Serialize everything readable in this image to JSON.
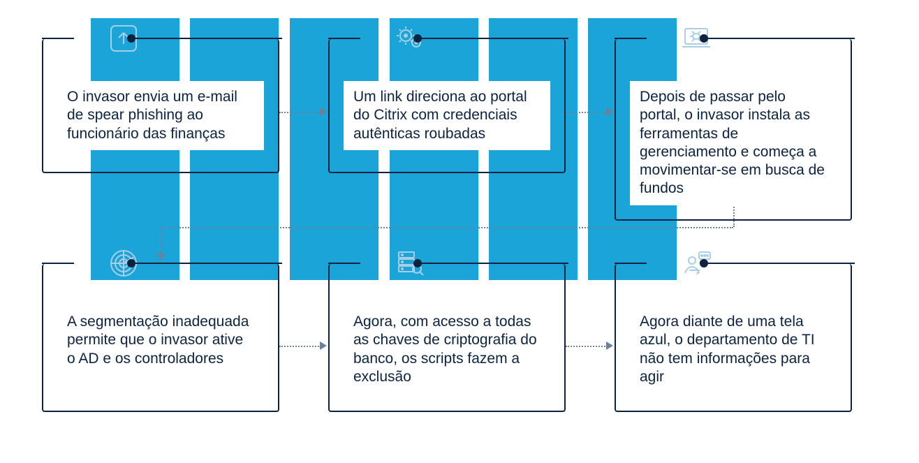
{
  "steps": {
    "s1": {
      "text": "O invasor envia um e‑mail de spear phishing ao funcionário das finanças"
    },
    "s2": {
      "text": "Um link direciona ao portal do Citrix com credenciais autênticas roubadas"
    },
    "s3": {
      "text": "Depois de passar pelo portal, o invasor instala as ferramentas de gerenciamento e começa a movimentar‑se em busca de fundos"
    },
    "s4": {
      "text": "A segmentação inadequada permite que o invasor ative o AD e os controladores"
    },
    "s5": {
      "text": "Agora, com acesso a todas as chaves de criptografia do banco, os scripts fazem a exclusão"
    },
    "s6": {
      "text": "Agora diante de uma tela azul, o departamento de TI não tem informações para agir"
    }
  },
  "icons": {
    "upload": "upload-icon",
    "gears": "gears-icon",
    "laptop": "laptop-bug-icon",
    "radar": "radar-icon",
    "server": "server-search-icon",
    "user": "user-chat-icon"
  }
}
